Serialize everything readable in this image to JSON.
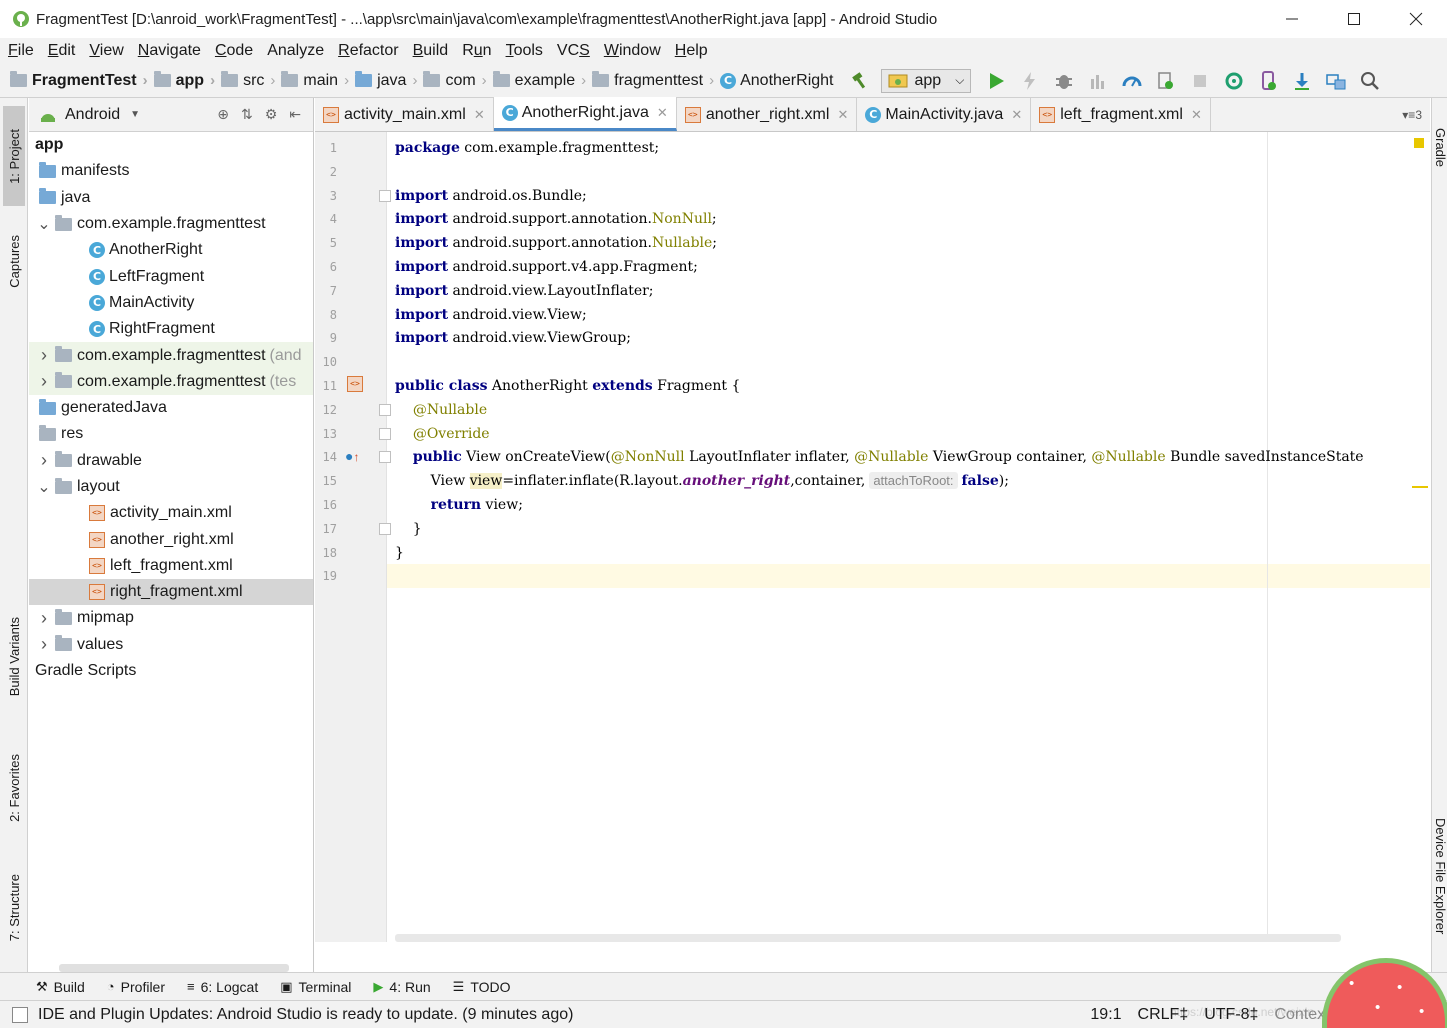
{
  "window": {
    "title": "FragmentTest [D:\\anroid_work\\FragmentTest] - ...\\app\\src\\main\\java\\com\\example\\fragmenttest\\AnotherRight.java [app] - Android Studio"
  },
  "menu": [
    "File",
    "Edit",
    "View",
    "Navigate",
    "Code",
    "Analyze",
    "Refactor",
    "Build",
    "Run",
    "Tools",
    "VCS",
    "Window",
    "Help"
  ],
  "menu_mnemonic": [
    "F",
    "E",
    "V",
    "N",
    "C",
    "",
    "R",
    "B",
    "u",
    "T",
    "S",
    "W",
    "H"
  ],
  "breadcrumbs": [
    "FragmentTest",
    "app",
    "src",
    "main",
    "java",
    "com",
    "example",
    "fragmenttest",
    "AnotherRight"
  ],
  "run_config": "app",
  "left_tabs": [
    "1: Project",
    "Captures",
    "Build Variants",
    "2: Favorites",
    "7: Structure"
  ],
  "right_tabs": [
    "Gradle",
    "Device File Explorer"
  ],
  "project": {
    "view_mode": "Android",
    "tree": [
      {
        "label": "app",
        "depth": 0,
        "icon": "module",
        "bold": true
      },
      {
        "label": "manifests",
        "depth": 1,
        "icon": "folder-blue"
      },
      {
        "label": "java",
        "depth": 1,
        "icon": "folder-blue"
      },
      {
        "label": "com.example.fragmenttest",
        "depth": 1,
        "icon": "package",
        "arrow": "down"
      },
      {
        "label": "AnotherRight",
        "depth": 2,
        "icon": "class"
      },
      {
        "label": "LeftFragment",
        "depth": 2,
        "icon": "class"
      },
      {
        "label": "MainActivity",
        "depth": 2,
        "icon": "class"
      },
      {
        "label": "RightFragment",
        "depth": 2,
        "icon": "class"
      },
      {
        "label": "com.example.fragmenttest",
        "suffix": "(and",
        "depth": 1,
        "icon": "package",
        "arrow": "right",
        "green": true
      },
      {
        "label": "com.example.fragmenttest",
        "suffix": "(tes",
        "depth": 1,
        "icon": "package",
        "arrow": "right",
        "green": true
      },
      {
        "label": "generatedJava",
        "depth": 1,
        "icon": "folder-blue"
      },
      {
        "label": "res",
        "depth": 1,
        "icon": "folder-res"
      },
      {
        "label": "drawable",
        "depth": 1,
        "icon": "folder",
        "arrow": "right"
      },
      {
        "label": "layout",
        "depth": 1,
        "icon": "folder",
        "arrow": "down"
      },
      {
        "label": "activity_main.xml",
        "depth": 2,
        "icon": "xml"
      },
      {
        "label": "another_right.xml",
        "depth": 2,
        "icon": "xml"
      },
      {
        "label": "left_fragment.xml",
        "depth": 2,
        "icon": "xml"
      },
      {
        "label": "right_fragment.xml",
        "depth": 2,
        "icon": "xml",
        "selected": true
      },
      {
        "label": "mipmap",
        "depth": 1,
        "icon": "folder",
        "arrow": "right"
      },
      {
        "label": "values",
        "depth": 1,
        "icon": "folder",
        "arrow": "right"
      },
      {
        "label": "Gradle Scripts",
        "depth": 0,
        "icon": "gradle"
      }
    ]
  },
  "tabs": [
    {
      "label": "activity_main.xml",
      "icon": "xml",
      "active": false
    },
    {
      "label": "AnotherRight.java",
      "icon": "class",
      "active": true
    },
    {
      "label": "another_right.xml",
      "icon": "xml",
      "active": false
    },
    {
      "label": "MainActivity.java",
      "icon": "class",
      "active": false
    },
    {
      "label": "left_fragment.xml",
      "icon": "xml",
      "active": false
    }
  ],
  "tab_overflow": "3",
  "code": {
    "current_line": 19,
    "lines": [
      [
        {
          "t": "package",
          "c": "kw"
        },
        {
          "t": " com.example.fragmenttest;"
        }
      ],
      [],
      [
        {
          "t": "import",
          "c": "kw"
        },
        {
          "t": " android.os.Bundle;"
        }
      ],
      [
        {
          "t": "import",
          "c": "kw"
        },
        {
          "t": " android.support.annotation."
        },
        {
          "t": "NonNull",
          "c": "ann"
        },
        {
          "t": ";"
        }
      ],
      [
        {
          "t": "import",
          "c": "kw"
        },
        {
          "t": " android.support.annotation."
        },
        {
          "t": "Nullable",
          "c": "ann"
        },
        {
          "t": ";"
        }
      ],
      [
        {
          "t": "import",
          "c": "kw"
        },
        {
          "t": " android.support.v4.app.Fragment;"
        }
      ],
      [
        {
          "t": "import",
          "c": "kw"
        },
        {
          "t": " android.view.LayoutInflater;"
        }
      ],
      [
        {
          "t": "import",
          "c": "kw"
        },
        {
          "t": " android.view.View;"
        }
      ],
      [
        {
          "t": "import",
          "c": "kw"
        },
        {
          "t": " android.view.ViewGroup;"
        }
      ],
      [],
      [
        {
          "t": "public class",
          "c": "kw"
        },
        {
          "t": " AnotherRight "
        },
        {
          "t": "extends",
          "c": "kw"
        },
        {
          "t": " Fragment {"
        }
      ],
      [
        {
          "t": "    "
        },
        {
          "t": "@Nullable",
          "c": "ann"
        }
      ],
      [
        {
          "t": "    "
        },
        {
          "t": "@Override",
          "c": "ann"
        }
      ],
      [
        {
          "t": "    "
        },
        {
          "t": "public",
          "c": "kw"
        },
        {
          "t": " View onCreateView("
        },
        {
          "t": "@NonNull",
          "c": "ann"
        },
        {
          "t": " LayoutInflater inflater, "
        },
        {
          "t": "@Nullable",
          "c": "ann"
        },
        {
          "t": " ViewGroup container, "
        },
        {
          "t": "@Nullable",
          "c": "ann"
        },
        {
          "t": " Bundle savedInstanceState"
        }
      ],
      [
        {
          "t": "        View "
        },
        {
          "t": "view",
          "c": "hl-word"
        },
        {
          "t": "=inflater.inflate(R.layout."
        },
        {
          "t": "another_right",
          "c": "fld"
        },
        {
          "t": ",container,"
        },
        {
          "t": "attachToRoot:",
          "c": "hint"
        },
        {
          "t": "false",
          "c": "kw"
        },
        {
          "t": ");"
        }
      ],
      [
        {
          "t": "        "
        },
        {
          "t": "return",
          "c": "kw"
        },
        {
          "t": " view;"
        }
      ],
      [
        {
          "t": "    }"
        }
      ],
      [
        {
          "t": "}"
        }
      ],
      []
    ]
  },
  "toolwindows": [
    {
      "label": "Build",
      "icon": "build-icon"
    },
    {
      "label": "Profiler",
      "icon": "profiler-icon"
    },
    {
      "label": "6: Logcat",
      "icon": "logcat-icon"
    },
    {
      "label": "Terminal",
      "icon": "terminal-icon"
    },
    {
      "label": "4: Run",
      "icon": "run-icon"
    },
    {
      "label": "TODO",
      "icon": "todo-icon"
    }
  ],
  "status": {
    "message": "IDE and Plugin Updates: Android Studio is ready to update. (9 minutes ago)",
    "position": "19:1",
    "line_sep": "CRLF‡",
    "encoding": "UTF-8‡",
    "context": "Context: <no context>",
    "watermark": "https://blog.csdn.net/weixin_43779100"
  },
  "colors": {
    "keyword": "#000080",
    "annotation": "#808000",
    "field": "#660e7a",
    "accent": "#4a88c7",
    "current_line": "#fffae3"
  }
}
